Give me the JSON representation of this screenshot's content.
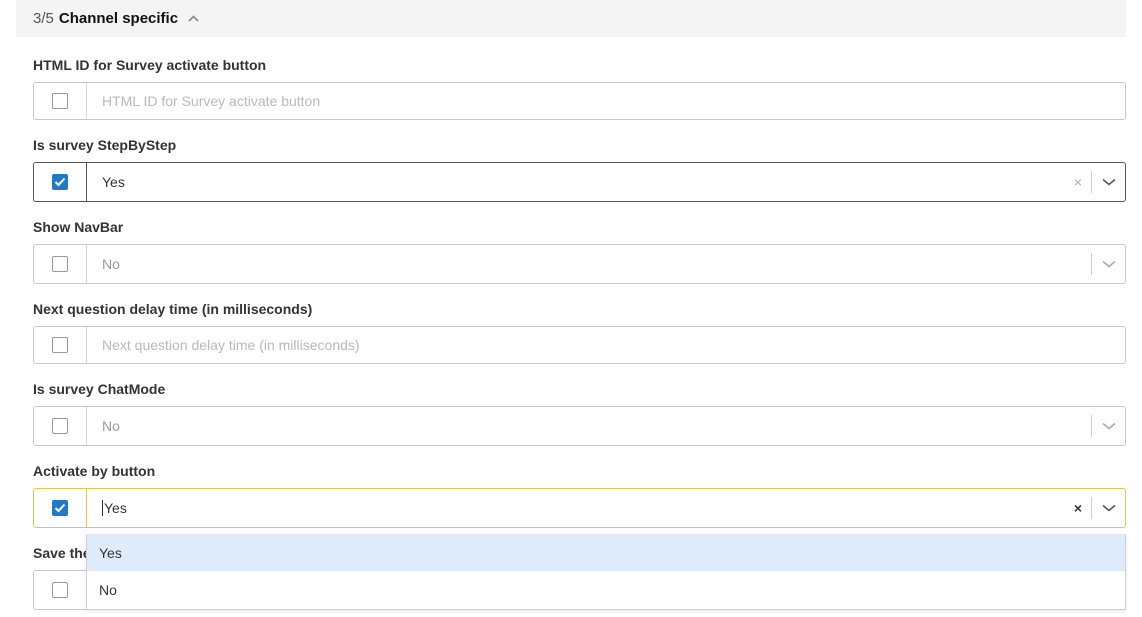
{
  "section": {
    "step": "3/5",
    "title": "Channel specific"
  },
  "fields": [
    {
      "label": "HTML ID for Survey activate button",
      "placeholder": "HTML ID for Survey activate button",
      "checked": false
    },
    {
      "label": "Is survey StepByStep",
      "value": "Yes",
      "checked": true
    },
    {
      "label": "Show NavBar",
      "value": "No",
      "checked": false
    },
    {
      "label": "Next question delay time (in milliseconds)",
      "placeholder": "Next question delay time (in milliseconds)",
      "checked": false
    },
    {
      "label": "Is survey ChatMode",
      "value": "No",
      "checked": false
    },
    {
      "label": "Activate by button",
      "value": "Yes",
      "checked": true
    },
    {
      "label": "Save the"
    }
  ],
  "clear_symbol": "×",
  "dropdown": {
    "options": [
      "Yes",
      "No"
    ],
    "highlighted": "Yes"
  },
  "colors": {
    "checkbox_checked": "#1f7ac8",
    "focus_border": "#e8c547",
    "option_highlight": "#deebfb",
    "header_bg": "#f4f4f4"
  },
  "icons": {
    "collapse": "chevron-up-icon",
    "expand": "chevron-down-icon",
    "clear": "clear-icon",
    "check": "checkmark-icon"
  }
}
